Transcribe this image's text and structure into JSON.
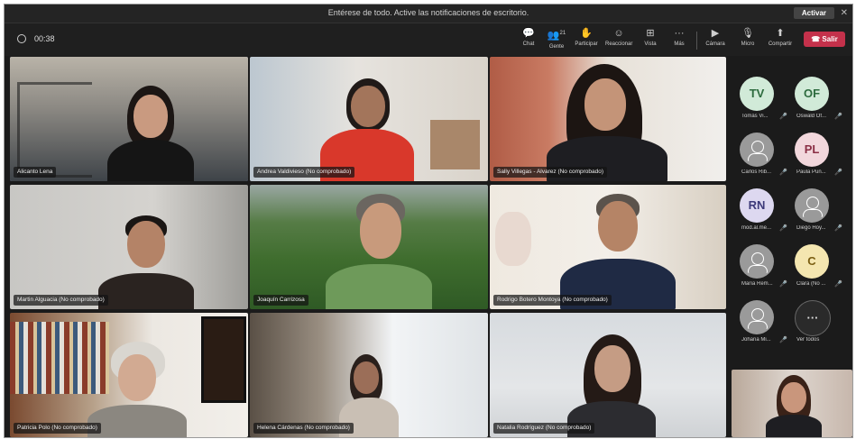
{
  "notification": {
    "text": "Entérese de todo. Active las notificaciones de escritorio.",
    "activate_label": "Activar",
    "close_icon": "close-icon"
  },
  "toolbar": {
    "timer": "00:38",
    "buttons": [
      {
        "label": "Chat",
        "icon": "chat-icon"
      },
      {
        "label": "Gente",
        "icon": "people-icon",
        "badge": "21"
      },
      {
        "label": "Participar",
        "icon": "raise-hand-icon"
      },
      {
        "label": "Reaccionar",
        "icon": "emoji-icon"
      },
      {
        "label": "Vista",
        "icon": "grid-view-icon"
      },
      {
        "label": "Más",
        "icon": "more-icon"
      },
      {
        "label": "Cámara",
        "icon": "camera-icon"
      },
      {
        "label": "Micro",
        "icon": "mic-icon"
      },
      {
        "label": "Compartir",
        "icon": "share-icon"
      }
    ],
    "leave_label": "Salir"
  },
  "tiles": [
    {
      "name": "Alicanto Lena"
    },
    {
      "name": "Andrea Valdivieso (No comprobado)"
    },
    {
      "name": "Sally Villegas - Alvarez (No comprobado)"
    },
    {
      "name": "Martin Alguacia (No comprobado)"
    },
    {
      "name": "Joaquín Carrizosa"
    },
    {
      "name": "Rodrigo Botero Montoya (No comprobado)"
    },
    {
      "name": "Patricia Polo (No comprobado)"
    },
    {
      "name": "Helena Cárdenas (No comprobado)"
    },
    {
      "name": "Natalia Rodríguez (No comprobado)"
    }
  ],
  "sidebar": [
    {
      "initials": "TV",
      "name": "Tomás Vi...",
      "color": "#d1ead8"
    },
    {
      "initials": "OF",
      "name": "Oswald Of...",
      "color": "#d1ead8"
    },
    {
      "initials": "",
      "name": "Carlos Rib...",
      "color": "#9a9a9a"
    },
    {
      "initials": "PL",
      "name": "Paula Pun...",
      "color": "#f2d7dc"
    },
    {
      "initials": "RN",
      "name": "mod.al.me...",
      "color": "#ddd8f0"
    },
    {
      "initials": "",
      "name": "Diego Hoy...",
      "color": "#9a9a9a"
    },
    {
      "initials": "",
      "name": "María Rem...",
      "color": "#9a9a9a"
    },
    {
      "initials": "C",
      "name": "Clara (No ...",
      "color": "#f4e6b0"
    },
    {
      "initials": "",
      "name": "Johana Mi...",
      "color": "#9a9a9a"
    }
  ],
  "more": {
    "label": "Ver todos",
    "icon": "ellipsis-icon"
  }
}
